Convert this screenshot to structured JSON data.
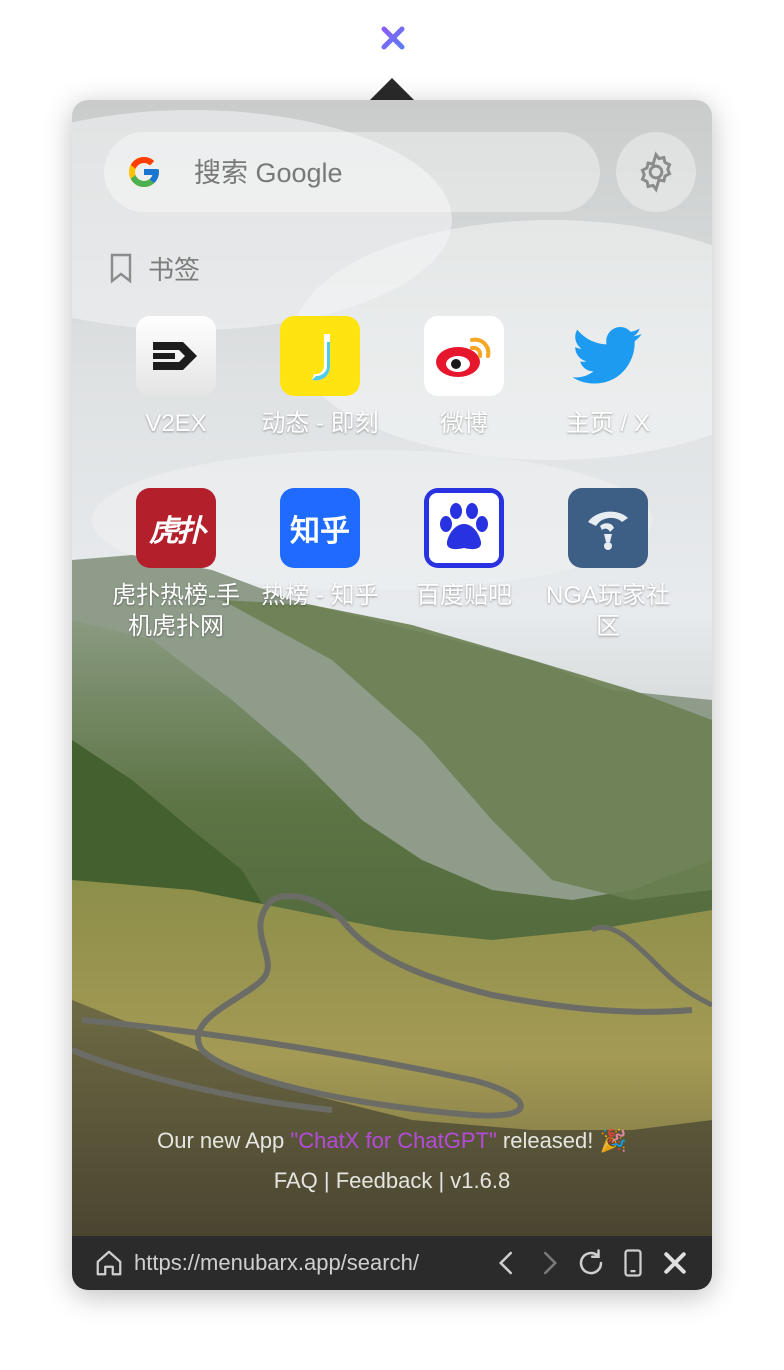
{
  "app": {
    "menubar_icon": "menubarx-x-icon"
  },
  "search": {
    "placeholder": "搜索 Google",
    "engine_icon": "google-g-icon"
  },
  "settings": {
    "icon": "gear-icon"
  },
  "bookmarks": {
    "title": "书签",
    "icon": "bookmark-icon",
    "items": [
      {
        "label": "V2EX",
        "icon": "v2ex-logo-icon",
        "color": "#f2f2f2"
      },
      {
        "label": "动态 - 即刻",
        "icon": "jike-logo-icon",
        "color": "#ffe411"
      },
      {
        "label": "微博",
        "icon": "weibo-logo-icon",
        "color": "#ffffff"
      },
      {
        "label": "主页 / X",
        "icon": "twitter-bird-icon",
        "color": "#1d9bf0"
      },
      {
        "label": "虎扑热榜-手机虎扑网",
        "icon": "hupu-logo-icon",
        "icon_text": "虎扑",
        "color": "#b3202c"
      },
      {
        "label": "热榜 - 知乎",
        "icon": "zhihu-logo-icon",
        "icon_text": "知乎",
        "color": "#1f6bff"
      },
      {
        "label": "百度贴吧",
        "icon": "baidu-tieba-paw-icon",
        "color": "#2932e1"
      },
      {
        "label": "NGA玩家社区",
        "icon": "nga-logo-icon",
        "color": "#3d5f86"
      }
    ]
  },
  "footer": {
    "announce_prefix": "Our new App ",
    "announce_link": "\"ChatX for ChatGPT\"",
    "announce_suffix": " released! 🎉",
    "faq": "FAQ",
    "sep1": " | ",
    "feedback": "Feedback",
    "sep2": " | ",
    "version": "v1.6.8"
  },
  "bottom_bar": {
    "url": "https://menubarx.app/search/",
    "home_icon": "home-icon",
    "back_icon": "chevron-left-icon",
    "forward_icon": "chevron-right-icon",
    "reload_icon": "reload-icon",
    "device_icon": "phone-icon",
    "close_icon": "close-icon"
  }
}
